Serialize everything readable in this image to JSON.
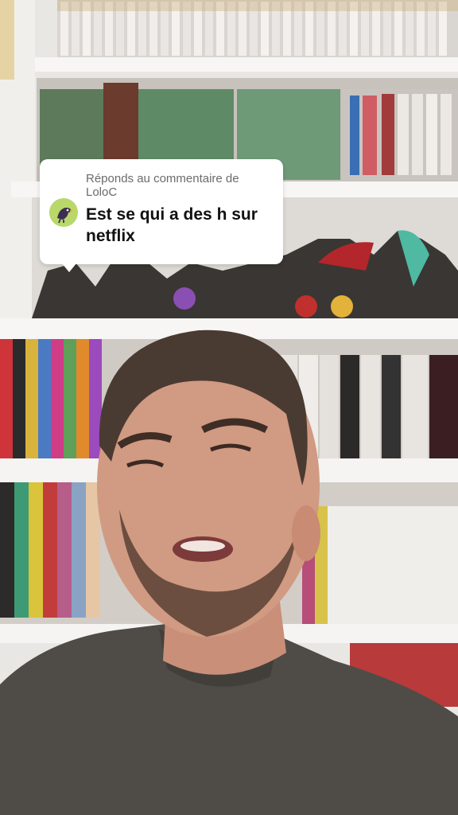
{
  "reply_card": {
    "label": "Réponds au commentaire de LoloC",
    "comment": "Est se qui a des h sur netflix",
    "avatar_icon": "crow-avatar-icon"
  },
  "colors": {
    "card_background": "#ffffff",
    "label_text": "#6b6b6b",
    "comment_text": "#111111",
    "avatar_background": "#b9d86a"
  }
}
